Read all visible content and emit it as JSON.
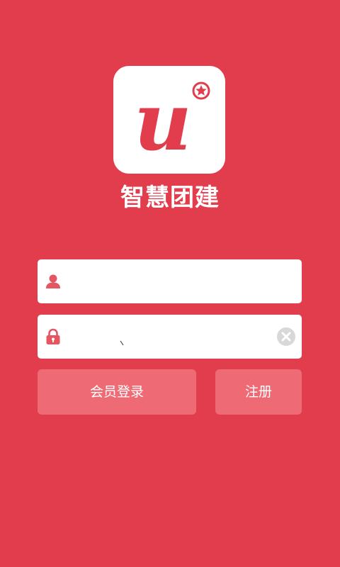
{
  "app": {
    "name": "智慧团建",
    "logo_letter": "u"
  },
  "form": {
    "username": {
      "value": "",
      "icon": "user-icon"
    },
    "password": {
      "value": "",
      "icon": "lock-icon",
      "clear_icon": "clear-icon"
    }
  },
  "buttons": {
    "login_label": "会员登录",
    "register_label": "注册"
  },
  "colors": {
    "background": "#e13d4c",
    "button": "#ee6b75",
    "icon": "#e35662",
    "clear_icon": "#d8d8d8"
  }
}
